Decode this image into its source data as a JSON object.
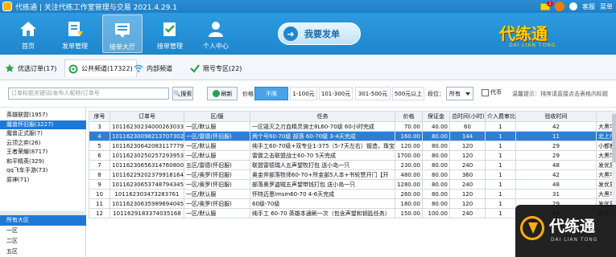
{
  "titlebar": {
    "title": "代练通 | 关注代练工作室管理与交易 2021.4.29.1",
    "mail_badge": "1",
    "bell_badge": "",
    "kefu": "客服",
    "menu": "菜单"
  },
  "toolbar": {
    "items": [
      {
        "label": "首页",
        "icon": "home-icon"
      },
      {
        "label": "发单管理",
        "icon": "send-order-icon"
      },
      {
        "label": "接单大厅",
        "icon": "order-hall-icon"
      },
      {
        "label": "接单管理",
        "icon": "receive-order-icon"
      },
      {
        "label": "个人中心",
        "icon": "user-icon"
      }
    ],
    "want_order": "我要发单",
    "brand": "代练通",
    "brand_sub": "DAI LIAN TONG"
  },
  "tabs": [
    {
      "label": "优选订单(17)",
      "icon": "star-icon"
    },
    {
      "label": "公共频道(17322)",
      "icon": "gear-icon"
    },
    {
      "label": "内部频道",
      "icon": "wifi-icon"
    },
    {
      "label": "限号专区(22)",
      "icon": "check-icon"
    }
  ],
  "filter": {
    "search_placeholder": "订单标题关键词/发布人昵称/订单号",
    "search_btn": "搜索",
    "refresh_btn": "刷新",
    "price_label": "价格：",
    "price_options": [
      "不限",
      "1-100元",
      "101-300元",
      "301-500元",
      "500元以上"
    ],
    "segment_label": "段位：",
    "segment_value": "所有",
    "daifa_label": "代币",
    "tip": "温馨提示：排序请直接点击表格内标题"
  },
  "sidebar": {
    "games": [
      "英雄联盟(1957)",
      "魔兽怀旧服(3227)",
      "魔兽正式服(7)",
      "云顶之弈(26)",
      "王者荣耀(8717)",
      "和平精英(329)",
      "qq飞车手游(73)",
      "原神(71)"
    ],
    "regions": [
      "所有大区",
      "一区",
      "二区",
      "五区"
    ]
  },
  "table": {
    "headers": [
      "序号",
      "订单号",
      "区/服",
      "任务",
      "价格",
      "保证金",
      "总时间(小时)",
      "介入费审比",
      "验收时间",
      "发布者"
    ],
    "rows": [
      [
        "3",
        "101162302340002630338",
        "一区/默认服",
        "一区毁灭之刃血精灵骑士8L60-70级 60小时完成",
        "70.00",
        "40.00",
        "60",
        "1",
        "42",
        "大黑牛在线"
      ],
      [
        "4",
        "10116230098213707302",
        "一区/雷德(怀旧服)",
        "两个号60-70级 部落 60-70级 3-4天完成",
        "160.00",
        "80.00",
        "144",
        "1",
        "11",
        "北上广者"
      ],
      [
        "5",
        "101162306420831177795",
        "一区/默认服",
        "纯手工60-70级+双专业1-375（5-7天左右）锻造，珠宝",
        "120.00",
        "80.00",
        "120",
        "1",
        "29",
        "小都都都都"
      ],
      [
        "6",
        "101162302502572939​53",
        "一区/默认服",
        "雷霆之击联盟战士60-70 5天完成",
        "1700.00",
        "80.00",
        "120",
        "1",
        "29",
        "大黑牛在线"
      ],
      [
        "7",
        "101162306563147608​00",
        "五区/雷德(怀旧服)",
        "联盟雷德瑞人五声望牧打包 送小岛一只",
        "230.00",
        "80.00",
        "240",
        "1",
        "48",
        "发优质单模"
      ],
      [
        "8",
        "101162292023799181​64",
        "一区/奥罗(怀旧服)",
        "奥金斧部落牧师60-70+所金部5人本+书轮赞开门【开",
        "480.00",
        "80.00",
        "360",
        "1",
        "42",
        "大黑牛在线"
      ],
      [
        "9",
        "101162306537487943​45",
        "一区/奥罗(怀旧服)",
        "部落奥罗盗贼五声望带钱打包 送小岛一只",
        "1280.00",
        "80.00",
        "240",
        "1",
        "48",
        "发优质单模"
      ],
      [
        "10",
        "101162303473283761",
        "一区/默认服",
        "怀特迈恩lmsm60-70 4-6天完成",
        "260.00",
        "80.00",
        "120",
        "1",
        "31",
        "大黑牛在线"
      ],
      [
        "11",
        "101162306359896940​45",
        "一区/奥罗(怀旧服)",
        "60级-70级",
        "180.00",
        "80.00",
        "120",
        "1",
        "29",
        "发优质单模"
      ],
      [
        "12",
        "101162918337403516​8",
        "一区/默认服",
        "纯手工 60-70 英雄本通刷一次（包含声望和钥匙任务）",
        "150.00",
        "100.00",
        "240",
        "1",
        "29",
        "桃子工作室"
      ]
    ],
    "selected_row": 1
  },
  "overlay": {
    "title": "代练通",
    "sub": "DAI LIAN TONG"
  }
}
